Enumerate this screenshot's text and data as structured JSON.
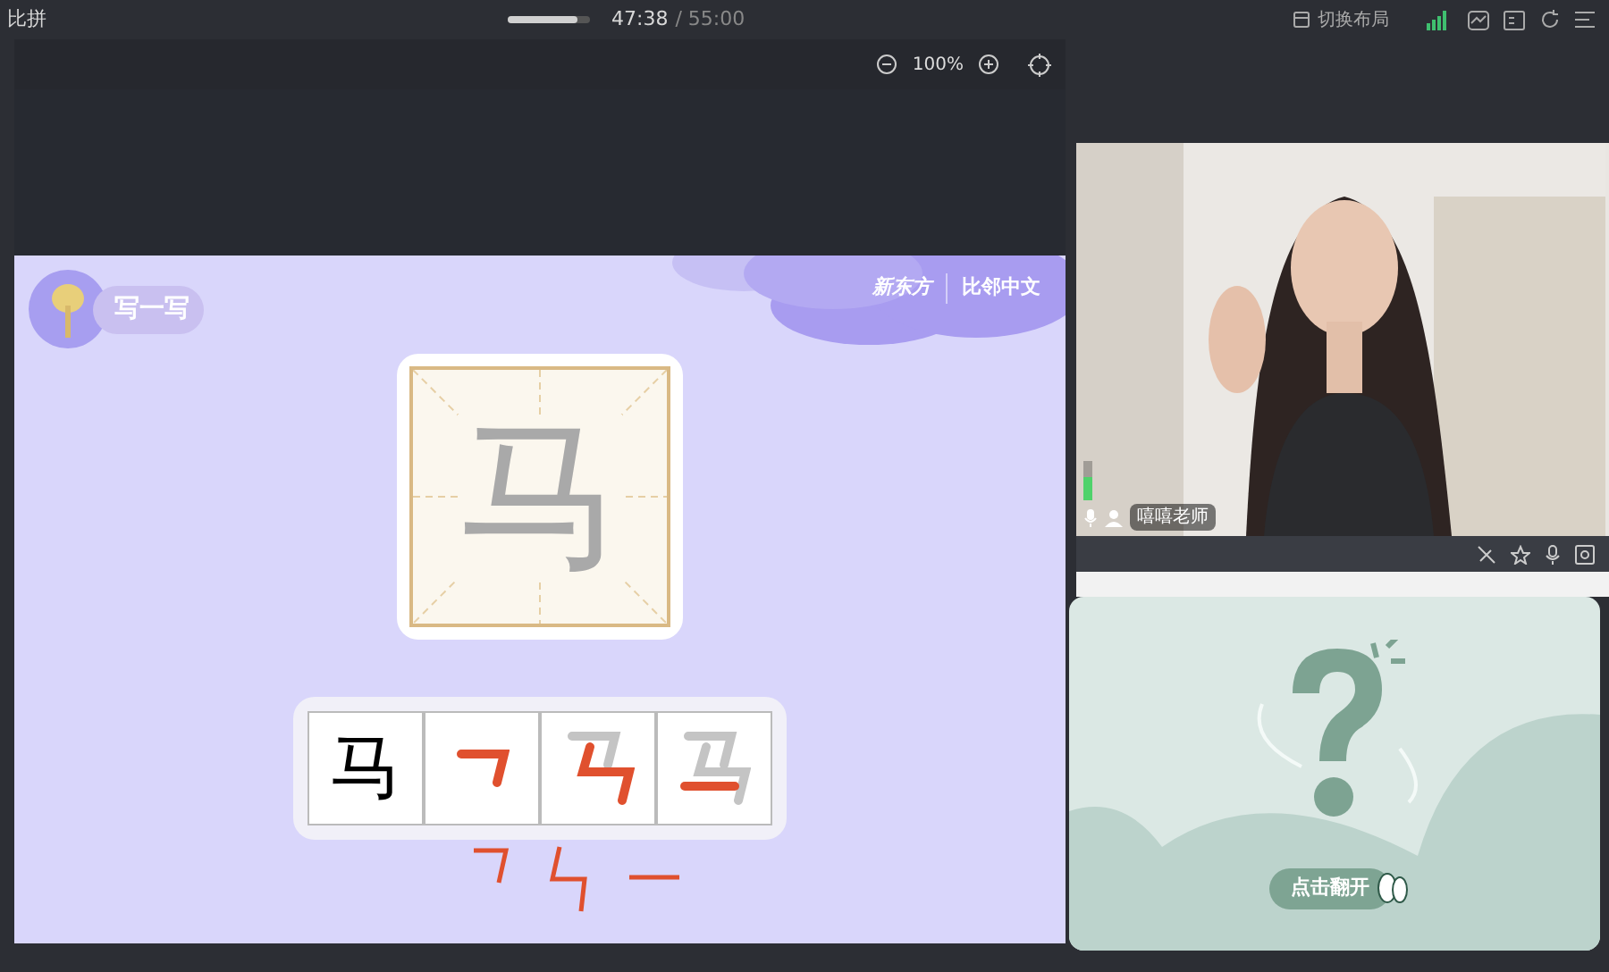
{
  "top_bar": {
    "title": "比拼",
    "progress": {
      "level": 0.85
    },
    "elapsed": "47:38",
    "total": "/ 55:00",
    "layout_button": "切换布局"
  },
  "toolbar": {
    "zoom": "100%"
  },
  "slide": {
    "badge": "写一写",
    "brand": [
      "新东方",
      "比邻中文"
    ],
    "character": "马",
    "stroke_cells": [
      {
        "kind": "char",
        "text": "马"
      },
      {
        "kind": "stroke"
      },
      {
        "kind": "stroke"
      },
      {
        "kind": "stroke"
      }
    ]
  },
  "video": {
    "name": "嘻嘻老师",
    "mic": {
      "level": 0.6
    }
  },
  "card": {
    "button": "点击翻开"
  }
}
